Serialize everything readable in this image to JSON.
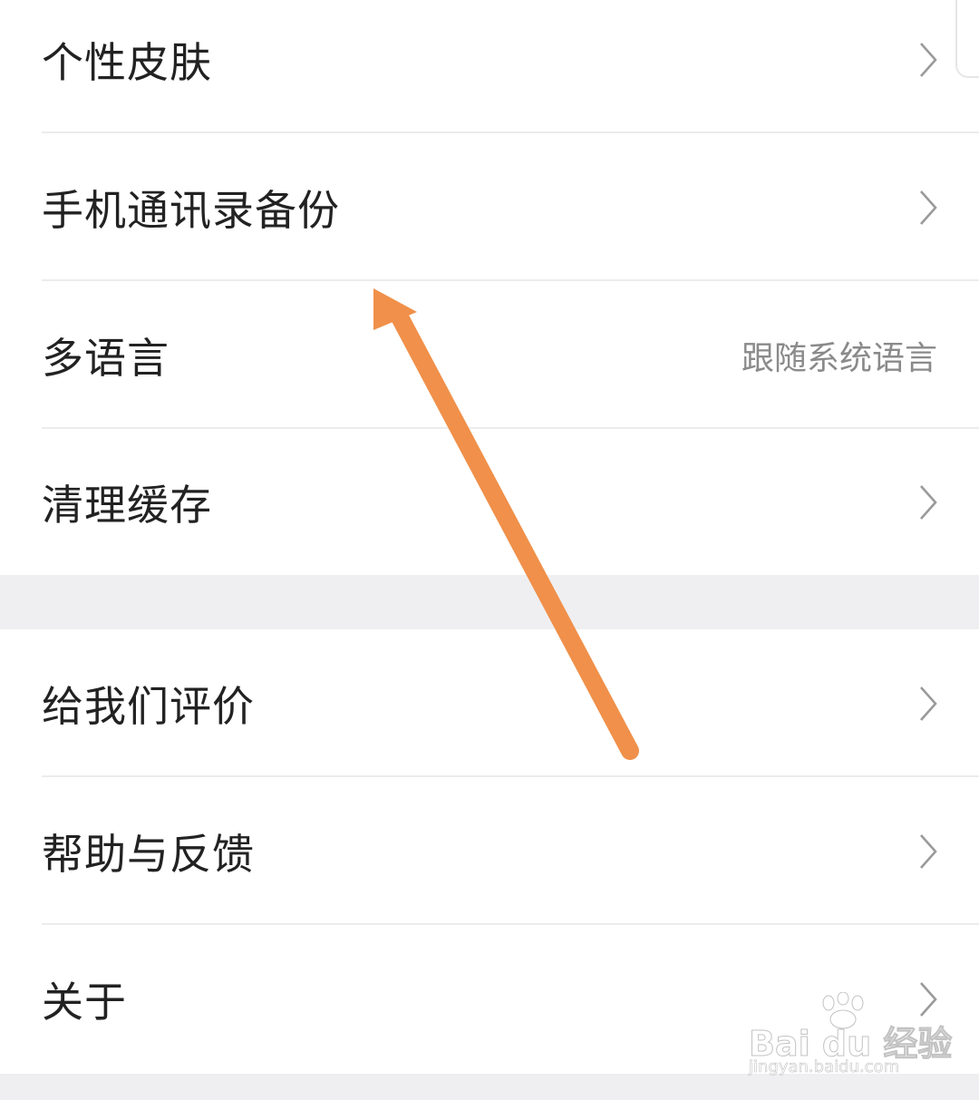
{
  "settings": {
    "group1": [
      {
        "label": "个性皮肤",
        "value": "",
        "chevron": true
      },
      {
        "label": "手机通讯录备份",
        "value": "",
        "chevron": true
      },
      {
        "label": "多语言",
        "value": "跟随系统语言",
        "chevron": false
      },
      {
        "label": "清理缓存",
        "value": "",
        "chevron": true
      }
    ],
    "group2": [
      {
        "label": "给我们评价",
        "value": "",
        "chevron": true
      },
      {
        "label": "帮助与反馈",
        "value": "",
        "chevron": true
      },
      {
        "label": "关于",
        "value": "",
        "chevron": true
      }
    ]
  },
  "annotation": {
    "arrow_color": "#f0904a",
    "points_to": "手机通讯录备份"
  },
  "watermark": {
    "brand": "Bai du 经验",
    "url": "jingyan.baidu.com"
  },
  "icons": {
    "row_chevron": "chevron-right-icon",
    "watermark_paw": "paw-icon"
  },
  "colors": {
    "label_text": "#222222",
    "value_text": "#8a8a8a",
    "divider": "#ececec",
    "section_gap": "#efeff1"
  }
}
